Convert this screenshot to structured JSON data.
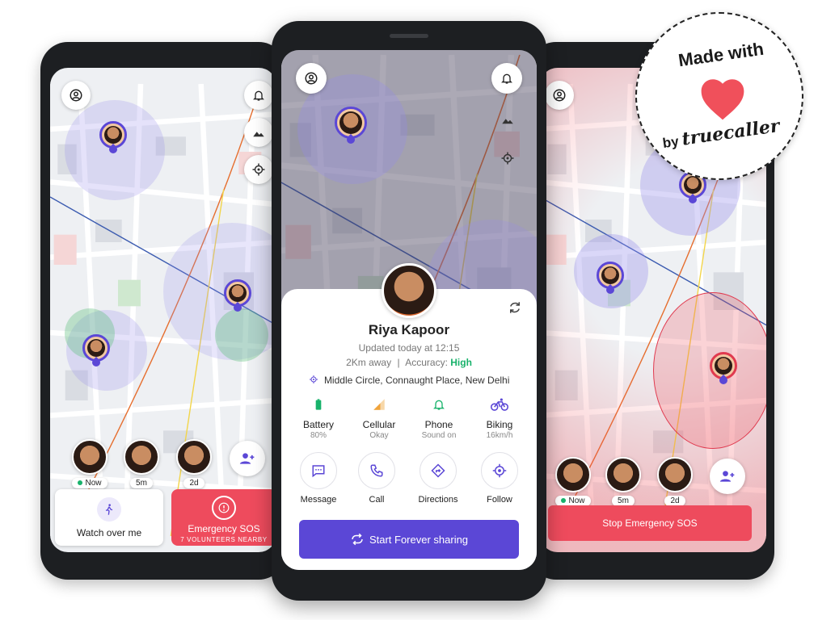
{
  "badge": {
    "line1": "Made with",
    "line2_prefix": "by",
    "brand": "truecaller",
    "heart_icon": "heart-icon",
    "heart_color": "#f0505b"
  },
  "colors": {
    "accent": "#5b47d6",
    "sos": "#ee4b5d",
    "high": "#18b26b"
  },
  "left_phone": {
    "members": [
      {
        "label": "Now",
        "online": true
      },
      {
        "label": "5m"
      },
      {
        "label": "2d"
      }
    ],
    "watch_label": "Watch over me",
    "sos_label": "Emergency SOS",
    "sos_sub": "7 VOLUNTEERS  NEARBY"
  },
  "center_phone": {
    "name": "Riya Kapoor",
    "updated": "Updated today at 12:15",
    "distance": "2Km away",
    "accuracy_label": "Accuracy:",
    "accuracy_value": "High",
    "address": "Middle Circle, Connaught Place, New Delhi",
    "stats": [
      {
        "label": "Battery",
        "sub": "80%",
        "icon": "battery-icon"
      },
      {
        "label": "Cellular",
        "sub": "Okay",
        "icon": "signal-icon"
      },
      {
        "label": "Phone",
        "sub": "Sound on",
        "icon": "bell-icon"
      },
      {
        "label": "Biking",
        "sub": "16km/h",
        "icon": "bike-icon"
      }
    ],
    "actions": [
      {
        "label": "Message",
        "icon": "message-icon"
      },
      {
        "label": "Call",
        "icon": "phone-icon"
      },
      {
        "label": "Directions",
        "icon": "directions-icon"
      },
      {
        "label": "Follow",
        "icon": "target-icon"
      }
    ],
    "cta": "Start Forever sharing"
  },
  "right_phone": {
    "members": [
      {
        "label": "Now",
        "online": true
      },
      {
        "label": "5m"
      },
      {
        "label": "2d"
      }
    ],
    "stop_label": "Stop Emergency SOS"
  }
}
